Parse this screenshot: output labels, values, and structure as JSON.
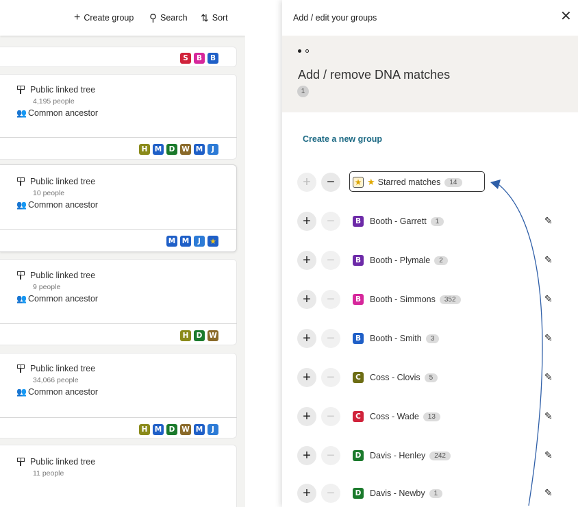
{
  "toolbar": {
    "create_group": "Create group",
    "search": "Search",
    "sort": "Sort"
  },
  "colors": {
    "S": "#d0233b",
    "B_pink": "#d6279b",
    "B_blue": "#1f5fc7",
    "B_purple": "#6d2aa8",
    "H": "#8a8a1a",
    "M": "#1f5fc7",
    "D": "#1b7a2c",
    "W": "#8a6a2a",
    "J": "#2d7bd6",
    "C_olive": "#6d6d14",
    "C_red": "#d0233b",
    "link": "#1d6a84"
  },
  "cards": [
    {
      "badges": [
        "S",
        "B",
        "B"
      ]
    },
    {
      "tree_label": "Public linked tree",
      "people": "4,195 people",
      "ancestor": "Common ancestor",
      "badges": [
        "H",
        "M",
        "D",
        "W",
        "M",
        "J"
      ]
    },
    {
      "tree_label": "Public linked tree",
      "people": "10 people",
      "ancestor": "Common ancestor",
      "badges": [
        "M",
        "M",
        "J",
        "★"
      ]
    },
    {
      "tree_label": "Public linked tree",
      "people": "9 people",
      "ancestor": "Common ancestor",
      "badges": [
        "H",
        "D",
        "W"
      ]
    },
    {
      "tree_label": "Public linked tree",
      "people": "34,066 people",
      "ancestor": "Common ancestor",
      "badges": [
        "H",
        "M",
        "D",
        "W",
        "M",
        "J"
      ]
    },
    {
      "tree_label": "Public linked tree",
      "people": "11 people"
    }
  ],
  "panel": {
    "title": "Add / edit your groups",
    "close": "✕",
    "heading": "Add / remove DNA matches",
    "count": "1",
    "create_link": "Create a new group",
    "groups": [
      {
        "letter": "★",
        "name": "Starred matches",
        "count": "14"
      },
      {
        "letter": "B",
        "name": "Booth - Garrett",
        "count": "1"
      },
      {
        "letter": "B",
        "name": "Booth - Plymale",
        "count": "2"
      },
      {
        "letter": "B",
        "name": "Booth - Simmons",
        "count": "352"
      },
      {
        "letter": "B",
        "name": "Booth - Smith",
        "count": "3"
      },
      {
        "letter": "C",
        "name": "Coss - Clovis",
        "count": "5"
      },
      {
        "letter": "C",
        "name": "Coss - Wade",
        "count": "13"
      },
      {
        "letter": "D",
        "name": "Davis - Henley",
        "count": "242"
      },
      {
        "letter": "D",
        "name": "Davis - Newby",
        "count": "1"
      }
    ]
  }
}
